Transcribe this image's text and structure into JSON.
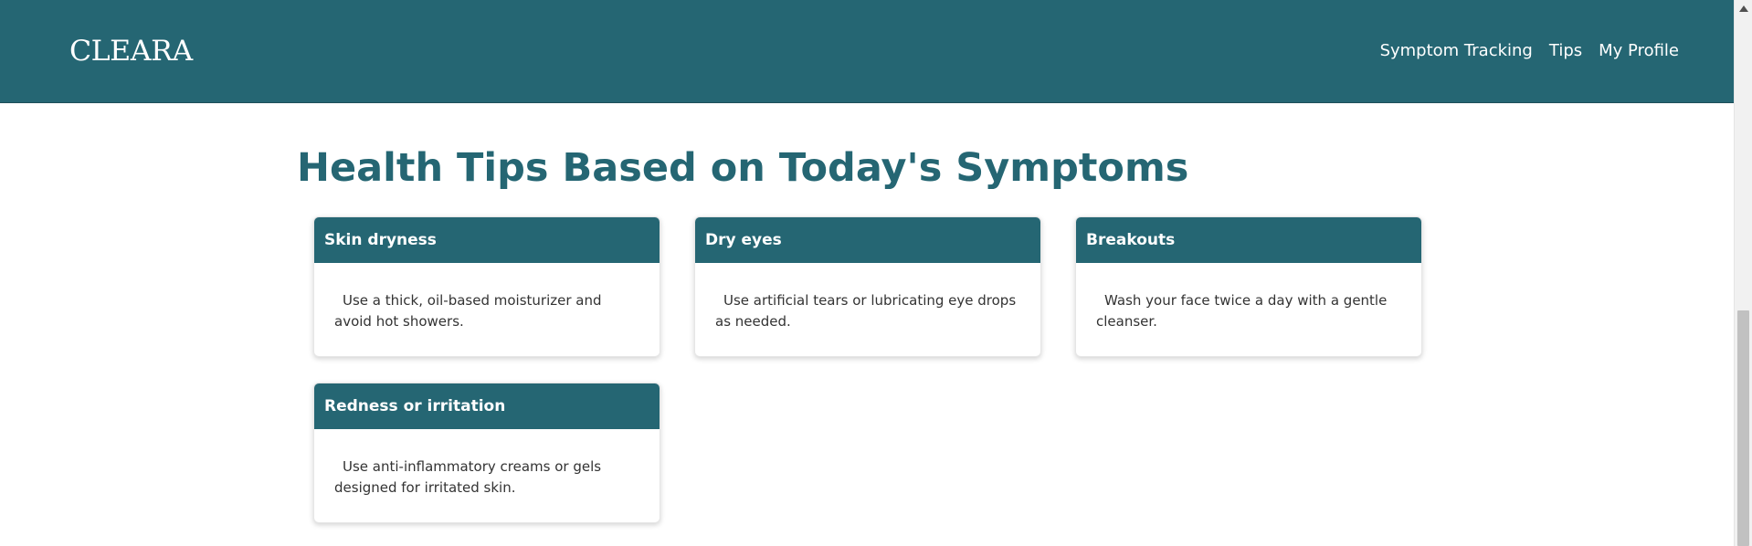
{
  "brand": {
    "logo": "CLEARA"
  },
  "nav": {
    "items": [
      {
        "label": "Symptom Tracking"
      },
      {
        "label": "Tips"
      },
      {
        "label": "My Profile"
      }
    ]
  },
  "main": {
    "title": "Health Tips Based on Today's Symptoms",
    "cards": [
      {
        "title": "Skin dryness",
        "tip": "Use a thick, oil-based moisturizer and avoid hot showers."
      },
      {
        "title": "Dry eyes",
        "tip": "Use artificial tears or lubricating eye drops as needed."
      },
      {
        "title": "Breakouts",
        "tip": "Wash your face twice a day with a gentle cleanser."
      },
      {
        "title": "Redness or irritation",
        "tip": "Use anti-inflammatory creams or gels designed for irritated skin."
      }
    ]
  },
  "colors": {
    "primary": "#256673",
    "page_background": "#ffffff",
    "card_text": "#333333"
  },
  "icons": {
    "scroll_up": "caret-up-icon"
  }
}
